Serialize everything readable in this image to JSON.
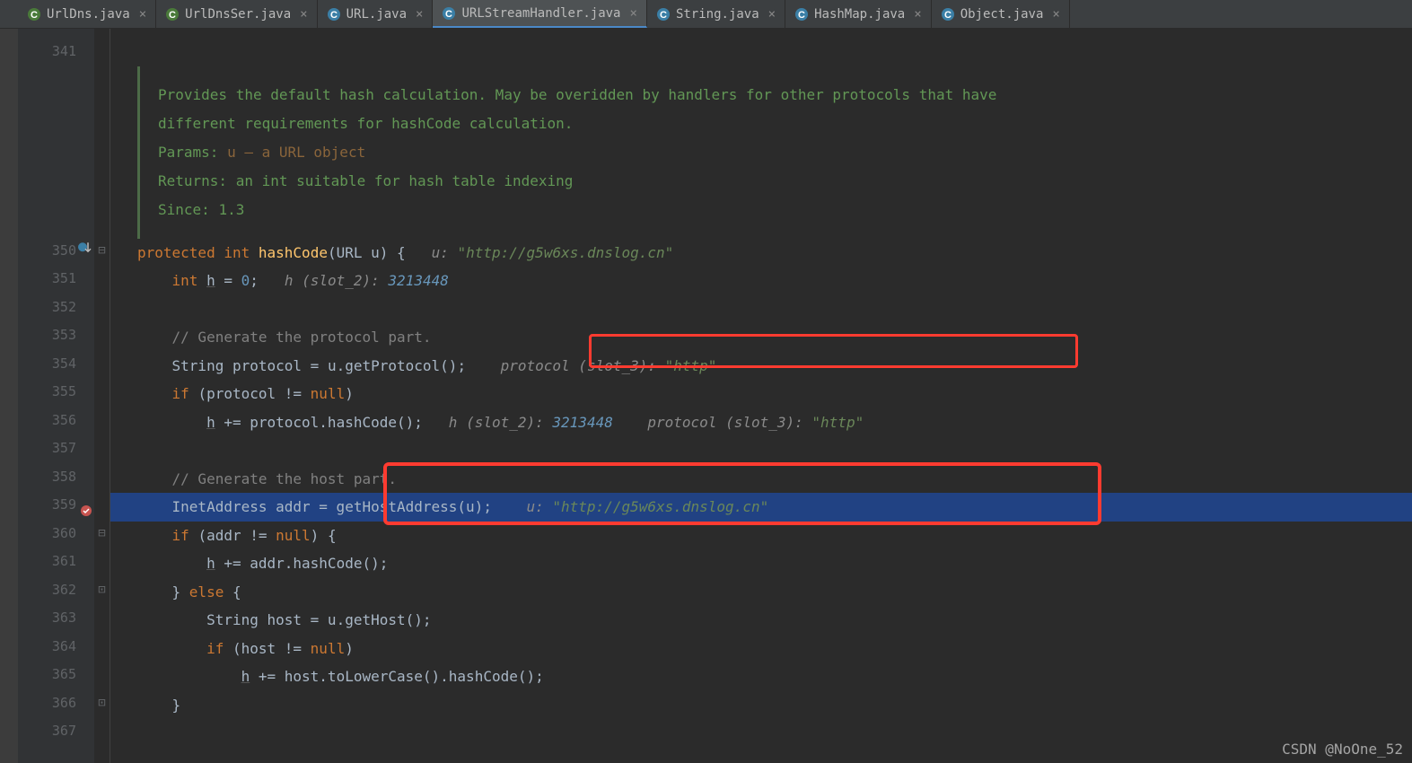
{
  "tabs": [
    {
      "label": "UrlDns.java",
      "icon": "class"
    },
    {
      "label": "UrlDnsSer.java",
      "icon": "class"
    },
    {
      "label": "URL.java",
      "icon": "lib"
    },
    {
      "label": "URLStreamHandler.java",
      "icon": "lib",
      "active": true
    },
    {
      "label": "String.java",
      "icon": "lib"
    },
    {
      "label": "HashMap.java",
      "icon": "lib"
    },
    {
      "label": "Object.java",
      "icon": "lib"
    }
  ],
  "gutter": {
    "start": 341,
    "lines": [
      341,
      350,
      351,
      352,
      353,
      354,
      355,
      356,
      357,
      358,
      359,
      360,
      361,
      362,
      363,
      364,
      365,
      366,
      367
    ]
  },
  "javadoc": {
    "desc1": "Provides the default hash calculation. May be overidden by handlers for other protocols that have",
    "desc2": "different requirements for hashCode calculation.",
    "params_label": "Params:",
    "params_text": "u – a URL object",
    "returns_label": "Returns:",
    "returns_text": "an int suitable for hash table indexing",
    "since_label": "Since:",
    "since_text": "1.3"
  },
  "code": {
    "l350": {
      "kw1": "protected",
      "kw2": "int",
      "name": "hashCode",
      "param": "URL u",
      "brace": "{",
      "hint_lbl": "u:",
      "hint_val": "\"http://g5w6xs.dnslog.cn\""
    },
    "l351": {
      "kw": "int",
      "var": "h",
      "assign": "= ",
      "val": "0",
      "semi": ";",
      "hint_lbl": "h (slot_2):",
      "hint_val": "3213448"
    },
    "l353": {
      "comment": "// Generate the protocol part."
    },
    "l354": {
      "type": "String",
      "var": "protocol = ",
      "call": "u.getProtocol()",
      "semi": ";",
      "hint_lbl": "protocol (slot_3):",
      "hint_val": "\"http\""
    },
    "l355": {
      "kw": "if",
      "cond": "(protocol != ",
      "null": "null",
      "close": ")"
    },
    "l356": {
      "var": "h",
      "op": " += protocol.hashCode();",
      "hint1_lbl": "h (slot_2):",
      "hint1_val": "3213448",
      "hint2_lbl": "protocol (slot_3):",
      "hint2_val": "\"http\""
    },
    "l358": {
      "comment": "// Generate the host part."
    },
    "l359": {
      "type": "InetAddress ",
      "var": "addr = getHostAddress(u)",
      "semi": ";",
      "hint_lbl": "u:",
      "hint_val": "\"http://g5w6xs.dnslog.cn\""
    },
    "l360": {
      "kw": "if",
      "cond": "(addr != ",
      "null": "null",
      "close": ") {"
    },
    "l361": {
      "var": "h",
      "op": " += addr.hashCode();"
    },
    "l362": {
      "close": "} ",
      "kw": "else",
      "open": " {"
    },
    "l363": {
      "type": "String ",
      "rest": "host = u.getHost();"
    },
    "l364": {
      "kw": "if",
      "cond": "(host != ",
      "null": "null",
      "close": ")"
    },
    "l365": {
      "var": "h",
      "op": " += host.toLowerCase().hashCode();"
    },
    "l366": {
      "close": "}"
    }
  },
  "watermark": "CSDN @NoOne_52"
}
